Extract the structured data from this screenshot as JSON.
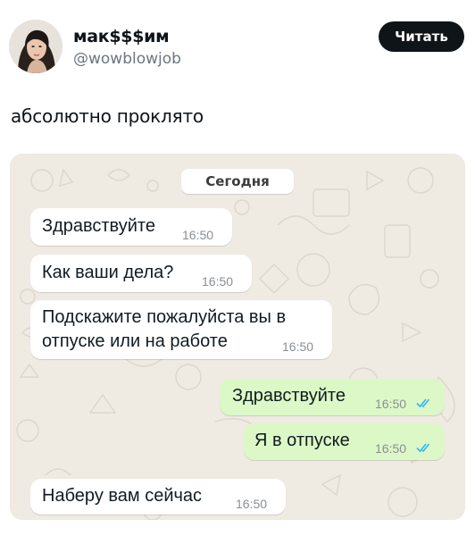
{
  "tweet": {
    "display_name": "мак$$$им",
    "handle": "@wowblowjob",
    "follow_label": "Читать",
    "text": "абсолютно проклято"
  },
  "chat": {
    "date_label": "Сегодня",
    "messages": [
      {
        "text": "Здравствуйте",
        "time": "16:50",
        "direction": "incoming"
      },
      {
        "text": "Как ваши дела?",
        "time": "16:50",
        "direction": "incoming"
      },
      {
        "text": "Подскажите пожалуйста вы в\nотпуске или на работе",
        "time": "16:50",
        "direction": "incoming"
      },
      {
        "text": "Здравствуйте",
        "time": "16:50",
        "direction": "outgoing",
        "status": "read"
      },
      {
        "text": "Я в отпуске",
        "time": "16:50",
        "direction": "outgoing",
        "status": "read"
      },
      {
        "text": "Наберу вам сейчас",
        "time": "16:50",
        "direction": "incoming"
      }
    ]
  },
  "colors": {
    "follow_button": "#0f1419",
    "chat_background": "#efeae2",
    "incoming_bubble": "#ffffff",
    "outgoing_bubble": "#dcf8c6",
    "read_ticks": "#34b7f1"
  },
  "icons": [
    "avatar",
    "double-check-icon",
    "chat-wallpaper-doodles"
  ]
}
